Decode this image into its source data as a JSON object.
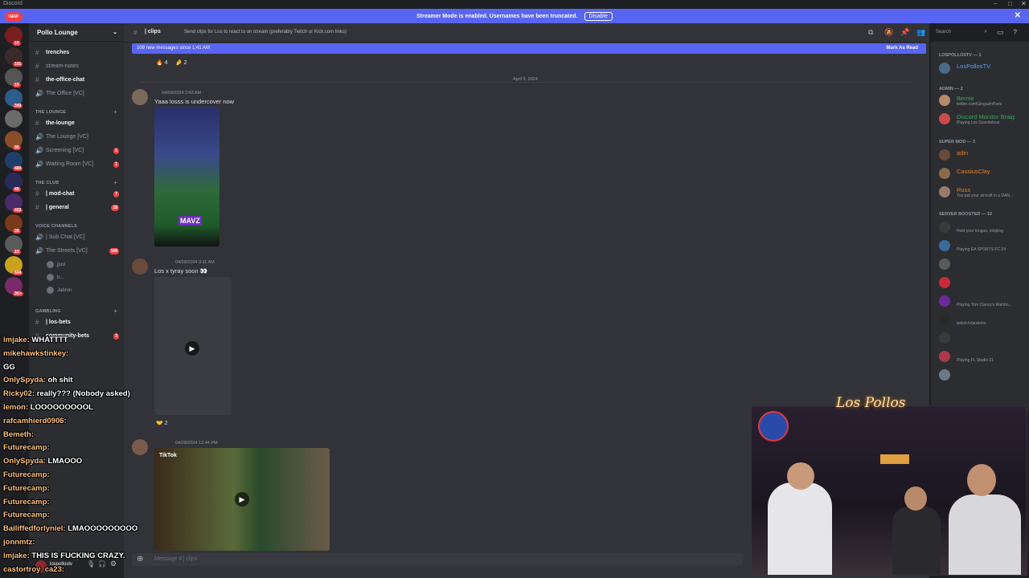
{
  "window": {
    "title": "Discord",
    "controls": [
      "–",
      "□",
      "✕"
    ]
  },
  "streamer_bar": {
    "text": "Streamer Mode is enabled. Usernames have been truncated.",
    "disable_label": "Disable"
  },
  "rail": {
    "new_label": "NEW",
    "badges": [
      "10",
      "191",
      "15",
      "349",
      "96",
      "480",
      "49",
      "422",
      "28",
      "19",
      "604",
      "3K+"
    ]
  },
  "server": {
    "name": "Pollo Lounge"
  },
  "channels": {
    "top": [
      {
        "name": "trenches",
        "unread": true
      },
      {
        "name": "stream-notes",
        "unread": false
      },
      {
        "name": "the-office-chat",
        "unread": true
      },
      {
        "name": "The Office [VC]",
        "unread": false
      }
    ],
    "cat_lounge": "THE LOUNGE",
    "lounge": [
      {
        "name": "the-lounge",
        "unread": true,
        "count": ""
      },
      {
        "name": "The Lounge [VC]",
        "unread": false,
        "count": ""
      },
      {
        "name": "Screening [VC]",
        "unread": false,
        "count": "1"
      },
      {
        "name": "Waiting Room [VC]",
        "unread": false,
        "count": "1"
      }
    ],
    "cat_club": "THE CLUB",
    "club": [
      {
        "name": "| mod-chat",
        "unread": true,
        "count": "7"
      },
      {
        "name": "| general",
        "unread": true,
        "count": "18"
      }
    ],
    "cat_voice": "VOICE CHANNELS",
    "voice": [
      {
        "name": "| Sub Chat [VC]",
        "count": ""
      },
      {
        "name": "The Streets [VC]",
        "count": "108"
      }
    ],
    "voice_users": [
      "jjust",
      "b...",
      "Jabron"
    ],
    "cat_gambling": "GAMBLING",
    "gambling": [
      {
        "name": "| los-bets",
        "unread": true,
        "count": ""
      },
      {
        "name": "community-bets",
        "unread": true,
        "count": "3"
      }
    ],
    "user": {
      "name": "lospollostv"
    }
  },
  "overlay_chat": [
    {
      "user": "imjake:",
      "text": "WHATTTT"
    },
    {
      "user": "mikehawkstinkey:",
      "text": ""
    },
    {
      "user": "",
      "text": "GG"
    },
    {
      "user": "OnlySpyda:",
      "text": "oh shit"
    },
    {
      "user": "Ricky02:",
      "text": "really??? (Nobody asked)"
    },
    {
      "user": "lemon:",
      "text": "LOOOOOOOOOL"
    },
    {
      "user": "rafcamhierd0906:",
      "text": ""
    },
    {
      "user": "Bemeth:",
      "text": ""
    },
    {
      "user": "Futurecamp:",
      "text": ""
    },
    {
      "user": "OnlySpyda:",
      "text": "LMAOOO"
    },
    {
      "user": "Futurecamp:",
      "text": ""
    },
    {
      "user": "Futurecamp:",
      "text": ""
    },
    {
      "user": "Futurecamp:",
      "text": ""
    },
    {
      "user": "Futurecamp:",
      "text": ""
    },
    {
      "user": "Bailiffedforlyniel:",
      "text": "LMAOOOOOOOOO"
    },
    {
      "user": "jonnmtz:",
      "text": ""
    },
    {
      "user": "imjake:",
      "text": "THIS IS FUCKING CRAZY."
    },
    {
      "user": "castortroy_ca23:",
      "text": ""
    }
  ],
  "channel_header": {
    "channel": "| clips",
    "topic": "Send clips for Los to react to on stream (preferably Twitch or Kick.com links)",
    "search_placeholder": "Search"
  },
  "new_messages": {
    "text": "109 new messages since 1:41 AM",
    "mark_read": "Mark As Read"
  },
  "date_divider": "April 9, 2024",
  "messages": [
    {
      "time": "04/09/2024 2:43 AM",
      "text": "Yaaa losss is undercover now",
      "embed_label": "MAVZ"
    },
    {
      "time": "04/09/2024 3:11 AM",
      "text": "Los x tyray soon 👀",
      "reaction": "2"
    },
    {
      "time": "04/09/2024 12:44 PM",
      "text": "",
      "embed_label": "TikTok"
    }
  ],
  "top_reactions": [
    "4",
    "2"
  ],
  "composer": {
    "placeholder": "Message # | clips"
  },
  "members": {
    "cat1": "LOSPOLLOSTV — 1",
    "g1": [
      {
        "name": "LosPollosTV",
        "color": "#4fa3ff",
        "status": ""
      }
    ],
    "cat2": "ADMIN — 2",
    "g2": [
      {
        "name": "Bernie",
        "color": "#3ba55c",
        "status": "twitter.com/GingazinParis"
      },
      {
        "name": "Discord Monitor Braig",
        "color": "#3ba55c",
        "status": "Playing Los Scandalous"
      }
    ],
    "cat3": "SUPER MOD — 3",
    "g3": [
      {
        "name": "adin",
        "color": "#e67e22",
        "status": ""
      },
      {
        "name": "CassiusClay",
        "color": "#e67e22",
        "status": ""
      },
      {
        "name": "Russ",
        "color": "#e67e22",
        "status": "You put your aircraft in a DAN..."
      }
    ],
    "cat4": "SERVER BOOSTER — 10",
    "g4": [
      {
        "name": "",
        "color": "#f47fff",
        "status": "Hold your tongue, stripling"
      },
      {
        "name": "",
        "color": "#f47fff",
        "status": "Playing EA SPORTS FC 24"
      },
      {
        "name": "",
        "color": "#f47fff",
        "status": ""
      },
      {
        "name": "",
        "color": "#f47fff",
        "status": ""
      },
      {
        "name": "",
        "color": "#f47fff",
        "status": "Playing Tom Clancy's Rainbo..."
      },
      {
        "name": "",
        "color": "#f47fff",
        "status": "twitch.tv/jeskohz"
      },
      {
        "name": "",
        "color": "#f47fff",
        "status": ""
      },
      {
        "name": "",
        "color": "#f47fff",
        "status": "Playing FL Studio 21"
      },
      {
        "name": "",
        "color": "#f47fff",
        "status": ""
      }
    ]
  },
  "webcam": {
    "signature": "Los Pollos"
  }
}
